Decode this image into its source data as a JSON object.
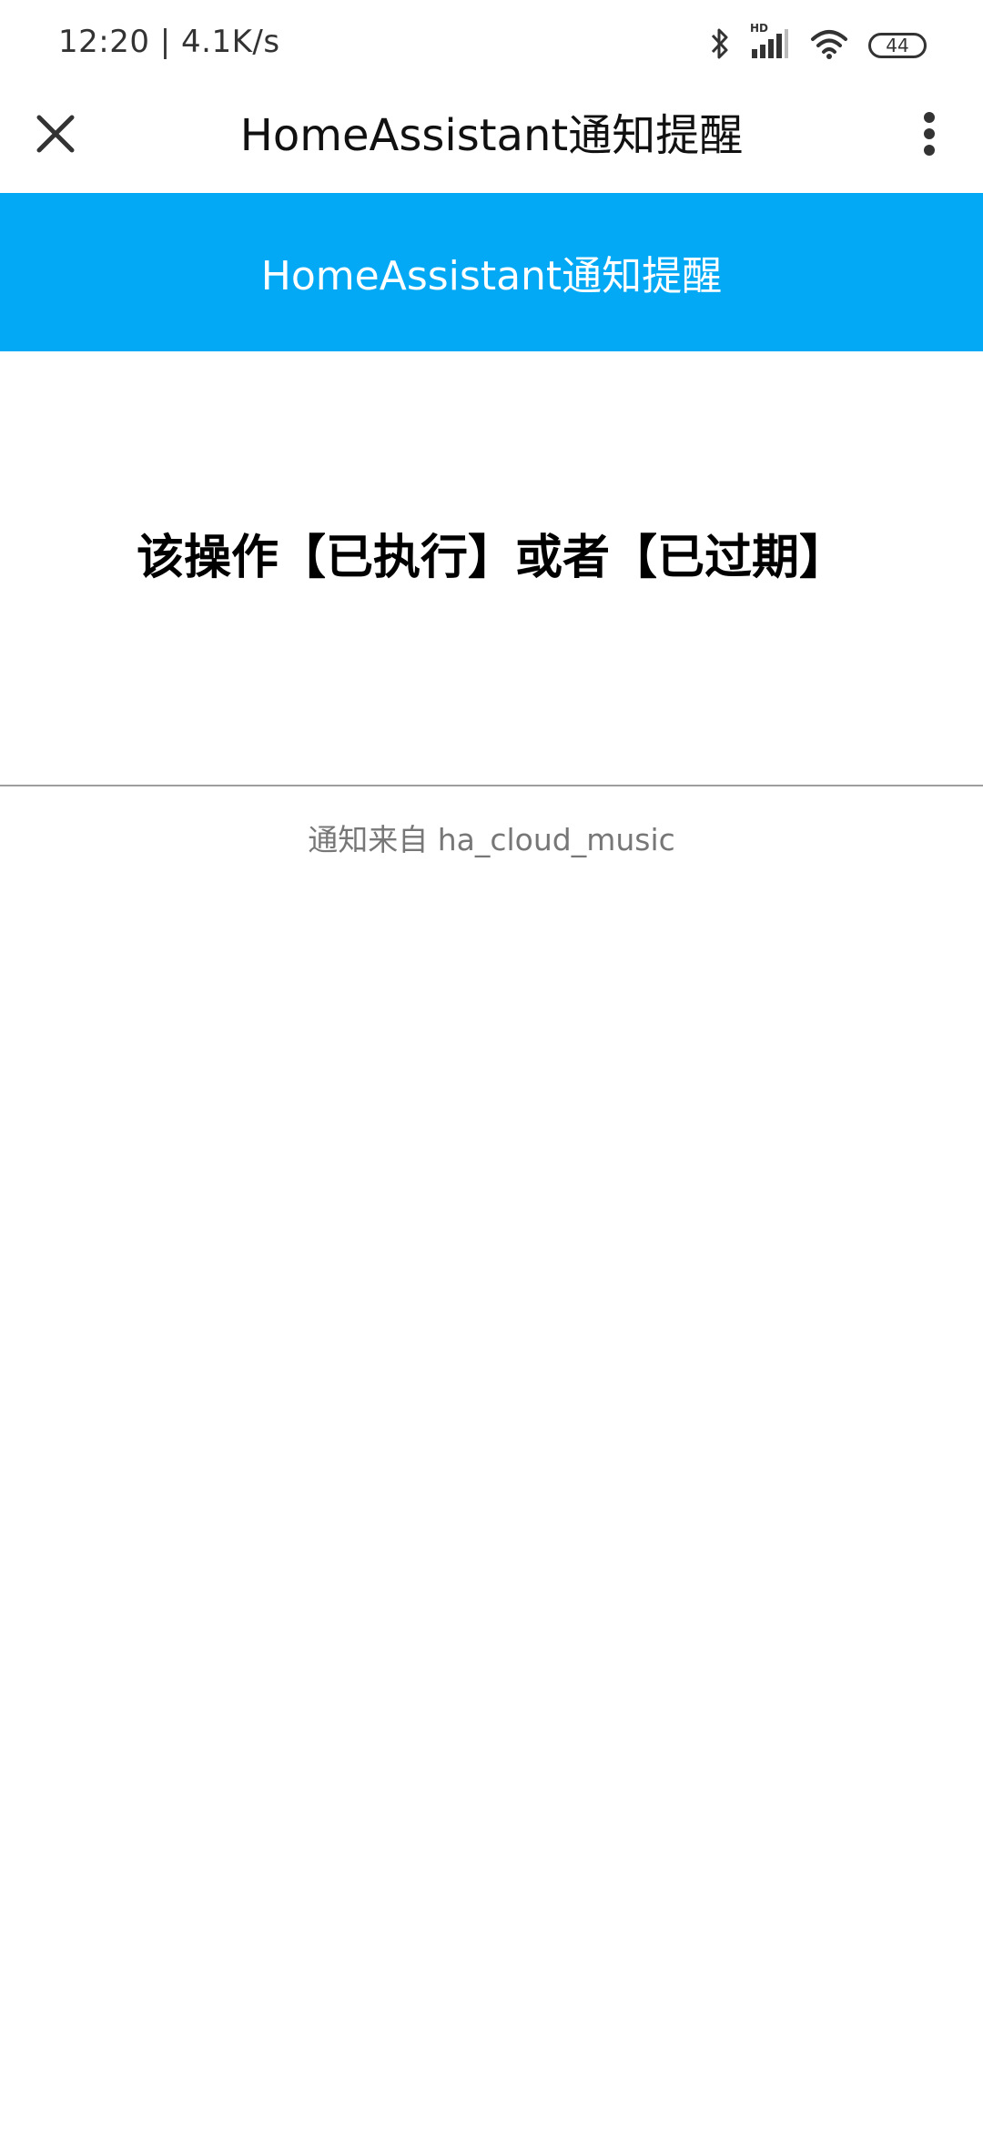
{
  "status_bar": {
    "time": "12:20 | 4.1K/s",
    "battery": "44",
    "network_badge": "HD",
    "icons": [
      "bluetooth-icon",
      "signal-icon",
      "wifi-icon",
      "battery-icon"
    ]
  },
  "title_bar": {
    "title": "HomeAssistant通知提醒",
    "close_icon": "close-icon",
    "more_icon": "more-vertical-icon"
  },
  "banner": {
    "title": "HomeAssistant通知提醒",
    "color": "#03a9f4"
  },
  "content": {
    "message": "该操作【已执行】或者【已过期】",
    "footer": "通知来自 ha_cloud_music"
  }
}
